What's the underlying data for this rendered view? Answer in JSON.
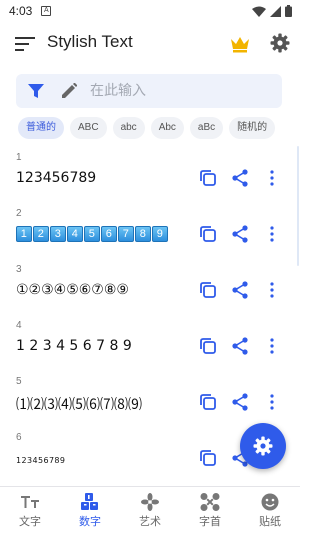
{
  "status_bar": {
    "time": "4:03",
    "notification": "A"
  },
  "app_bar": {
    "title": "Stylish Text"
  },
  "input": {
    "placeholder": "在此输入",
    "value": ""
  },
  "chips": [
    {
      "label": "普通的",
      "active": true
    },
    {
      "label": "ABC",
      "active": false
    },
    {
      "label": "abc",
      "active": false
    },
    {
      "label": "Abc",
      "active": false
    },
    {
      "label": "aBc",
      "active": false
    },
    {
      "label": "随机的",
      "active": false
    }
  ],
  "rows": [
    {
      "num": "1",
      "text": "123456789"
    },
    {
      "num": "2",
      "text": "1⃣2⃣3⃣4⃣5⃣6⃣7⃣8⃣9⃣"
    },
    {
      "num": "3",
      "text": "①②③④⑤⑥⑦⑧⑨"
    },
    {
      "num": "4",
      "text": "1 2 3 4 5 6 7 8 9"
    },
    {
      "num": "5",
      "text": "⑴⑵⑶⑷⑸⑹⑺⑻⑼"
    },
    {
      "num": "6",
      "text": "123456789"
    }
  ],
  "bottom_nav": [
    {
      "label": "文字",
      "icon": "text-icon",
      "active": false
    },
    {
      "label": "数字",
      "icon": "numbers-icon",
      "active": true
    },
    {
      "label": "艺术",
      "icon": "art-icon",
      "active": false
    },
    {
      "label": "字首",
      "icon": "initials-icon",
      "active": false
    },
    {
      "label": "贴纸",
      "icon": "sticker-icon",
      "active": false
    }
  ],
  "colors": {
    "accent": "#2f5bea",
    "crown": "#f2b400",
    "input_bg": "#eef2fb"
  }
}
